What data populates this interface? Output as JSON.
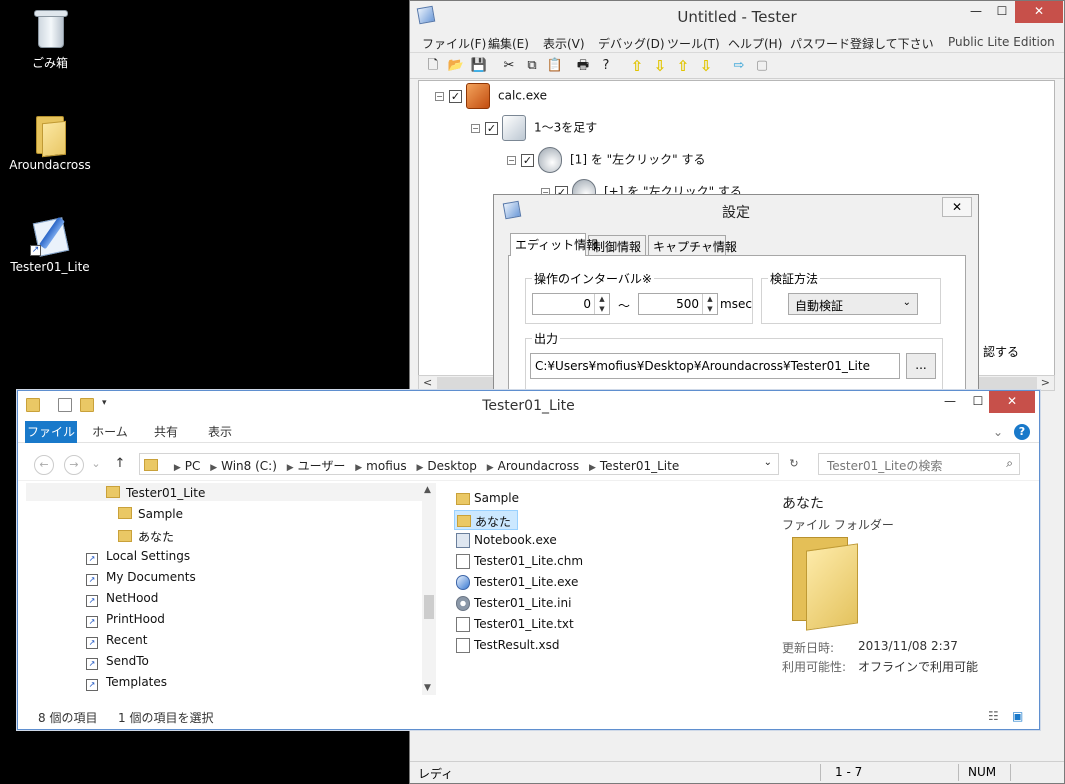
{
  "desktop": {
    "icons": [
      {
        "label": "ごみ箱"
      },
      {
        "label": "Aroundacross"
      },
      {
        "label": "Tester01_Lite"
      }
    ]
  },
  "tester": {
    "title": "Untitled - Tester",
    "window_buttons": {
      "minimize": "—",
      "maximize": "☐",
      "close": "✕"
    },
    "menu": [
      "ファイル(F)",
      "編集(E)",
      "表示(V)",
      "デバッグ(D)",
      "ツール(T)",
      "ヘルプ(H)",
      "パスワード登録して下さい"
    ],
    "edition": "Public Lite Edition",
    "toolbar_icons": [
      "new-icon",
      "open-icon",
      "save-icon",
      "cut-icon",
      "copy-icon",
      "paste-icon",
      "print-icon",
      "help-icon",
      "arrow-up-icon",
      "arrow-down-icon",
      "arrow-top-icon",
      "arrow-bottom-icon",
      "run-icon",
      "stop-icon"
    ],
    "toolbar_glyphs": [
      "🗋",
      "📂",
      "💾",
      "✂",
      "⧉",
      "📋",
      "🖶",
      "?",
      "⇧",
      "⇩",
      "⇧",
      "⇩",
      "⇨",
      "▢"
    ],
    "tree": [
      {
        "label": "calc.exe",
        "checked": "✓"
      },
      {
        "label": "1～3を足す",
        "checked": "✓"
      },
      {
        "label": "[1] を \"左クリック\" する",
        "checked": "✓"
      },
      {
        "label": "[+] を \"左クリック\" する",
        "checked": "✓"
      }
    ],
    "tree_partial_text": "認する",
    "scroll_left": "<",
    "scroll_right": ">",
    "status": {
      "ready": "レディ",
      "position": "1 -  7",
      "num": "NUM"
    }
  },
  "settings": {
    "title": "設定",
    "close": "✕",
    "tabs": [
      "エディット情報",
      "制御情報",
      "キャプチャ情報"
    ],
    "interval_label": "操作のインターバル※",
    "interval_min": "0",
    "interval_tilde": "～",
    "interval_max": "500",
    "interval_unit": "msec",
    "verify_label": "検証方法",
    "verify_value": "自動検証",
    "output_label": "出力",
    "output_path": "C:¥Users¥mofius¥Desktop¥Aroundacross¥Tester01_Lite",
    "browse_label": "..."
  },
  "explorer": {
    "title": "Tester01_Lite",
    "window_buttons": {
      "minimize": "—",
      "maximize": "☐",
      "close": "✕"
    },
    "ribbon_tabs": [
      "ファイル",
      "ホーム",
      "共有",
      "表示"
    ],
    "nav": {
      "back": "←",
      "forward": "→",
      "recent": "⌄",
      "up": "↑",
      "refresh": "↻"
    },
    "address": [
      "PC",
      "Win8 (C:)",
      "ユーザー",
      "mofius",
      "Desktop",
      "Aroundacross",
      "Tester01_Lite"
    ],
    "search_placeholder": "Tester01_Liteの検索",
    "nav_tree": [
      "Tester01_Lite",
      "Sample",
      "あなた",
      "Local Settings",
      "My Documents",
      "NetHood",
      "PrintHood",
      "Recent",
      "SendTo",
      "Templates"
    ],
    "files": [
      {
        "name": "Sample",
        "icon": "folder-icon"
      },
      {
        "name": "あなた",
        "icon": "folder-icon"
      },
      {
        "name": "Notebook.exe",
        "icon": "exe-icon"
      },
      {
        "name": "Tester01_Lite.chm",
        "icon": "help-file-icon"
      },
      {
        "name": "Tester01_Lite.exe",
        "icon": "tester-app-icon"
      },
      {
        "name": "Tester01_Lite.ini",
        "icon": "settings-file-icon"
      },
      {
        "name": "Tester01_Lite.txt",
        "icon": "text-file-icon"
      },
      {
        "name": "TestResult.xsd",
        "icon": "document-icon"
      }
    ],
    "preview": {
      "name": "あなた",
      "type": "ファイル フォルダー",
      "modified_label": "更新日時:",
      "modified_value": "2013/11/08 2:37",
      "availability_label": "利用可能性:",
      "availability_value": "オフラインで利用可能"
    },
    "status": {
      "item_count": "8 個の項目",
      "selected_count": "1 個の項目を選択"
    }
  }
}
